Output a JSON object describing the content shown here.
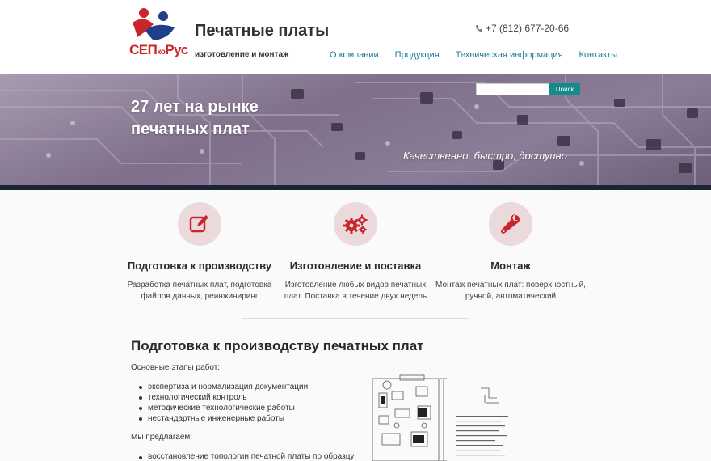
{
  "header": {
    "logo_main": "СЕП",
    "logo_ko": "ко",
    "logo_end": "Рус",
    "title": "Печатные платы",
    "subtitle": "изготовление и монтаж",
    "phone": "+7 (812) 677-20-66",
    "nav": [
      {
        "label": "О компании"
      },
      {
        "label": "Продукция"
      },
      {
        "label": "Техническая информация"
      },
      {
        "label": "Контакты"
      }
    ]
  },
  "hero": {
    "title": "27 лет на рынке печатных плат",
    "tagline": "Качественно, быстро, доступно",
    "search_value": "",
    "search_button": "Поиск"
  },
  "features": [
    {
      "icon": "edit-icon",
      "title": "Подготовка к производству",
      "text": "Разработка печатных плат, подготовка файлов данных, реинжиниринг"
    },
    {
      "icon": "gears-icon",
      "title": "Изготовление и поставка",
      "text": "Изготовление любых видов печатных плат. Поставка в течение двух недель"
    },
    {
      "icon": "wrench-icon",
      "title": "Монтаж",
      "text": "Монтаж печатных плат: поверхностный, ручной, автоматический"
    }
  ],
  "article": {
    "title": "Подготовка к производству печатных плат",
    "stages_intro": "Основные этапы работ:",
    "stages": [
      "экспертиза и нормализация документации",
      "технологический контроль",
      "методические технологические работы",
      "нестандартные инженерные работы"
    ],
    "offer_intro": "Мы предлагаем:",
    "offers": [
      "восстановление топологии печатной платы по образцу"
    ]
  },
  "colors": {
    "accent": "#1c7a9a",
    "brand_red": "#c8262c",
    "brand_blue": "#1f3f8a",
    "search_button": "#168a8a",
    "icon_circle": "#ebd9dc"
  }
}
